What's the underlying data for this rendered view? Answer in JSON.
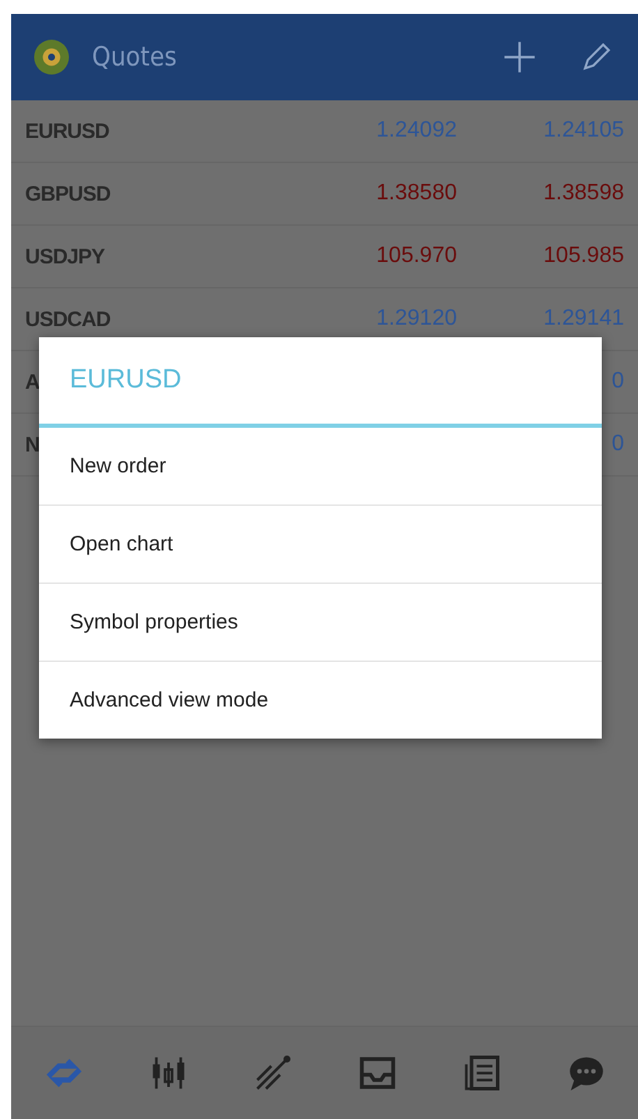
{
  "header": {
    "title": "Quotes"
  },
  "quotes": [
    {
      "symbol": "EURUSD",
      "bid": "1.24092",
      "ask": "1.24105",
      "color": "#2d5597"
    },
    {
      "symbol": "GBPUSD",
      "bid": "1.38580",
      "ask": "1.38598",
      "color": "#6a0c0c"
    },
    {
      "symbol": "USDJPY",
      "bid": "105.970",
      "ask": "105.985",
      "color": "#6a0c0c"
    },
    {
      "symbol": "USDCAD",
      "bid": "1.29120",
      "ask": "1.29141",
      "color": "#2d5597"
    },
    {
      "symbol": "A",
      "ask": "0",
      "color": "#2d5597"
    },
    {
      "symbol": "N",
      "ask": "0",
      "color": "#2d5597"
    }
  ],
  "dialog": {
    "title": "EURUSD",
    "items": [
      "New order",
      "Open chart",
      "Symbol properties",
      "Advanced view mode"
    ]
  },
  "nav": [
    {
      "kind": "quotes",
      "selected": true
    },
    {
      "kind": "chart",
      "selected": false
    },
    {
      "kind": "trade",
      "selected": false
    },
    {
      "kind": "history",
      "selected": false
    },
    {
      "kind": "news",
      "selected": false
    },
    {
      "kind": "chat",
      "selected": false
    }
  ]
}
